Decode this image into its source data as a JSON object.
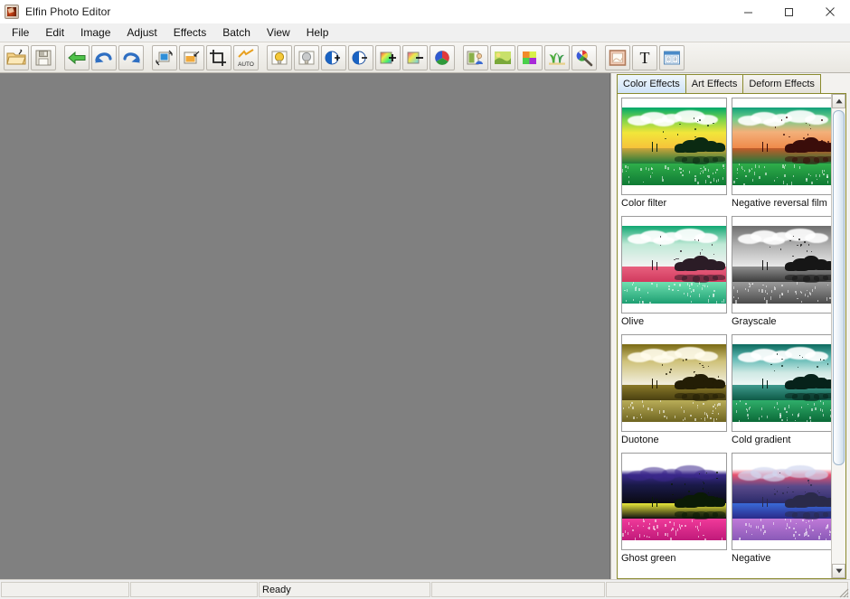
{
  "window": {
    "title": "Elfin Photo Editor",
    "icon": "photo-app-icon",
    "controls": {
      "minimize": "minimize-icon",
      "maximize": "maximize-icon",
      "close": "close-icon"
    }
  },
  "menubar": {
    "items": [
      {
        "label": "File"
      },
      {
        "label": "Edit"
      },
      {
        "label": "Image"
      },
      {
        "label": "Adjust"
      },
      {
        "label": "Effects"
      },
      {
        "label": "Batch"
      },
      {
        "label": "View"
      },
      {
        "label": "Help"
      }
    ]
  },
  "toolbar": {
    "groups": [
      {
        "buttons": [
          {
            "icon": "open-folder-icon",
            "title": "Open"
          },
          {
            "icon": "save-disk-icon",
            "title": "Save"
          }
        ]
      },
      {
        "buttons": [
          {
            "icon": "back-arrow-icon",
            "title": "Back"
          },
          {
            "icon": "undo-icon",
            "title": "Undo"
          },
          {
            "icon": "redo-icon",
            "title": "Redo"
          }
        ]
      },
      {
        "buttons": [
          {
            "icon": "resize-image-icon",
            "title": "Resize"
          },
          {
            "icon": "canvas-size-icon",
            "title": "Canvas size"
          },
          {
            "icon": "crop-icon",
            "title": "Crop"
          },
          {
            "icon": "auto-level-icon",
            "title": "Auto level"
          }
        ]
      },
      {
        "buttons": [
          {
            "icon": "brightness-up-icon",
            "title": "Brightness up"
          },
          {
            "icon": "brightness-down-icon",
            "title": "Brightness down"
          },
          {
            "icon": "contrast-up-icon",
            "title": "Contrast up"
          },
          {
            "icon": "contrast-down-icon",
            "title": "Contrast down"
          },
          {
            "icon": "saturation-up-icon",
            "title": "Saturation up"
          },
          {
            "icon": "saturation-down-icon",
            "title": "Saturation down"
          },
          {
            "icon": "color-balance-icon",
            "title": "Color balance"
          }
        ]
      },
      {
        "buttons": [
          {
            "icon": "photo-frame-icon",
            "title": "Frame"
          },
          {
            "icon": "art-effect-icon",
            "title": "Art effect"
          },
          {
            "icon": "color-effect-icon",
            "title": "Color effect"
          },
          {
            "icon": "clipart-icon",
            "title": "Clip art"
          },
          {
            "icon": "color-picker-icon",
            "title": "Color picker"
          }
        ]
      },
      {
        "buttons": [
          {
            "icon": "border-icon",
            "title": "Border"
          },
          {
            "icon": "text-tool-icon",
            "title": "Text"
          },
          {
            "icon": "calendar-icon",
            "title": "Calendar"
          }
        ]
      }
    ]
  },
  "panel": {
    "tabs": [
      {
        "label": "Color Effects",
        "active": true
      },
      {
        "label": "Art Effects",
        "active": false
      },
      {
        "label": "Deform Effects",
        "active": false
      }
    ],
    "effects": [
      {
        "label": "Color filter",
        "preset": "color-filter"
      },
      {
        "label": "Negative reversal film",
        "preset": "negative-reversal-film"
      },
      {
        "label": "Olive",
        "preset": "olive"
      },
      {
        "label": "Grayscale",
        "preset": "grayscale"
      },
      {
        "label": "Duotone",
        "preset": "duotone"
      },
      {
        "label": "Cold gradient",
        "preset": "cold-gradient"
      },
      {
        "label": "Ghost green",
        "preset": "ghost-green"
      },
      {
        "label": "Negative",
        "preset": "negative"
      }
    ],
    "scrollbar": {
      "up_icon": "scroll-up-arrow-icon",
      "down_icon": "scroll-down-arrow-icon"
    }
  },
  "statusbar": {
    "panes": [
      {
        "text": ""
      },
      {
        "text": ""
      },
      {
        "text": "Ready"
      },
      {
        "text": ""
      },
      {
        "text": ""
      }
    ],
    "grip": "resize-grip-icon"
  },
  "colors": {
    "canvas": "#808080",
    "tab_active": "#cfe3f7",
    "tab_border": "#8a8a2e",
    "chrome": "#f0f0f0"
  },
  "thumb_styles": {
    "color-filter": {
      "sky": "linear-gradient(#00a86b,#7bd44a 30%,#f2e63a 62%,#f6c23a 100%)",
      "water": "linear-gradient(#caa43a,#1f7a3a)",
      "ground": "linear-gradient(#2fae4a,#0f7a34)",
      "tree": "#0b2a12",
      "cloud": "rgba(255,255,255,.9)"
    },
    "negative-reversal-film": {
      "sky": "linear-gradient(#12a07a,#6fcf8a 28%,#f3b07a 60%,#ef8a4a 100%)",
      "water": "linear-gradient(#c25b2a,#1f7a3a)",
      "ground": "linear-gradient(#2fae4a,#0f7a34)",
      "tree": "#3a0d0a",
      "cloud": "rgba(255,255,255,.9)"
    },
    "olive": {
      "sky": "linear-gradient(#0fa771,#bfe9d6 45%,#f3f3f3 100%)",
      "water": "linear-gradient(#e8607f,#d13a5e)",
      "ground": "linear-gradient(#6fe0b0,#1e9f72)",
      "tree": "#2b1c26",
      "cloud": "rgba(255,255,255,.92)"
    },
    "grayscale": {
      "sky": "linear-gradient(#6e6e6e,#b4b4b4 50%,#e9e9e9 100%)",
      "water": "linear-gradient(#8f8f8f,#3d3d3d)",
      "ground": "linear-gradient(#9b9b9b,#4b4b4b)",
      "tree": "#161616",
      "cloud": "rgba(255,255,255,.9)"
    },
    "duotone": {
      "sky": "linear-gradient(#7a6a14,#cfc27a 42%,#f2efe0 100%)",
      "water": "linear-gradient(#8a7a2a,#4a4010)",
      "ground": "linear-gradient(#b9ad58,#6e6420)",
      "tree": "#231d05",
      "cloud": "rgba(255,252,235,.9)"
    },
    "cold-gradient": {
      "sky": "linear-gradient(#0c6a5e,#5fb9b4 35%,#cfe9e4 70%,#eef7f5 100%)",
      "water": "linear-gradient(#3f9a8e,#0d5a46)",
      "ground": "linear-gradient(#2fae6a,#0b6a38)",
      "tree": "#06221a",
      "cloud": "rgba(255,255,255,.92)"
    },
    "ghost-green": {
      "sky": "linear-gradient(#ffffff,#ffffff 18%,#3a2a8a 30%,#1a1a4a 55%,#0a0a12 100%)",
      "water": "linear-gradient(#e8e83a,#101010)",
      "ground": "linear-gradient(#f03a9a,#c01a7a)",
      "tree": "#0a1a06",
      "cloud": "rgba(60,40,140,.55)"
    },
    "negative": {
      "sky": "linear-gradient(#ffffff,#ffffff 16%,#e8536f 30%,#5a4a8a 58%,#2a2a6a 100%)",
      "water": "linear-gradient(#3a6ad8,#2a2a8a)",
      "ground": "linear-gradient(#c07ad8,#8a5ab8)",
      "tree": "#2a2a4a",
      "cloud": "rgba(210,215,240,.7)"
    }
  }
}
